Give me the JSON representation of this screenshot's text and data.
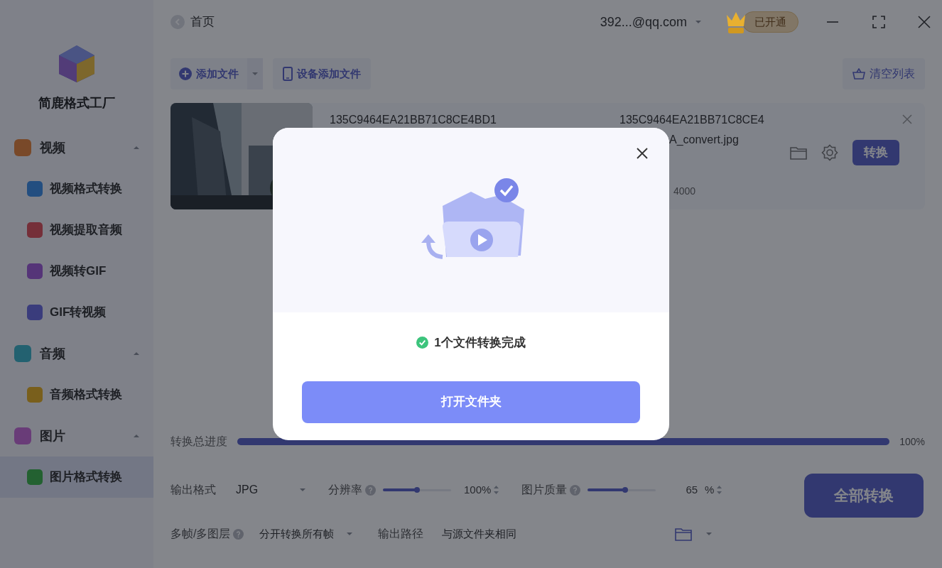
{
  "app": {
    "name": "简鹿格式工厂"
  },
  "sidebar": [
    {
      "label": "视频",
      "kind": "video",
      "expanded": true,
      "children": [
        {
          "label": "视频格式转换",
          "kind": "video-convert",
          "selected": false
        },
        {
          "label": "视频提取音频",
          "kind": "extract-audio",
          "selected": false
        },
        {
          "label": "视频转GIF",
          "kind": "to-gif",
          "selected": false
        },
        {
          "label": "GIF转视频",
          "kind": "from-gif",
          "selected": false
        }
      ]
    },
    {
      "label": "音频",
      "kind": "audio",
      "expanded": true,
      "children": [
        {
          "label": "音频格式转换",
          "kind": "audio-convert",
          "selected": false
        }
      ]
    },
    {
      "label": "图片",
      "expanded": true,
      "children": [
        {
          "label": "图片格式转换",
          "kind": "image-convert",
          "selected": true
        }
      ]
    }
  ],
  "header": {
    "breadcrumb": "首页",
    "account": "392...@qq.com",
    "vip": "已开通"
  },
  "toolbar": {
    "add_file": "添加文件",
    "device_add": "设备添加文件",
    "clear": "清空列表"
  },
  "files": [
    {
      "source_name": "135C9464EA21BB71C8CE4BD1",
      "output_name": "135C9464EA21BB71C8CE4",
      "output_name_rest": "A_convert.jpg",
      "info": "4000",
      "convert": "转换"
    }
  ],
  "progress": {
    "label": "转换总进度",
    "level": 1,
    "reading": "100%"
  },
  "settings": {
    "format_label": "输出格式",
    "format": "JPG",
    "resolution_label": "分辨率",
    "resolution_slider": {
      "level": 0.5
    },
    "resolution": "100%",
    "quality_label": "图片质量",
    "quality_slider": {
      "level": 0.55
    },
    "quality": "65",
    "quality_unit": "%",
    "frames_label": "多帧/多图层",
    "frames": "分开转换所有帧",
    "path_label": "输出路径",
    "path": "与源文件夹相同"
  },
  "convert_all": "全部转换",
  "dialog": {
    "message": "1个文件转换完成",
    "button": "打开文件夹"
  }
}
